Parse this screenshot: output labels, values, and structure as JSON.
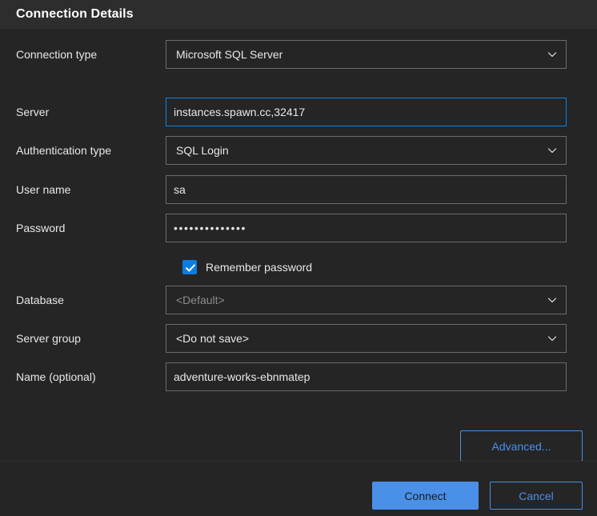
{
  "dialog": {
    "title": "Connection Details"
  },
  "fields": {
    "connection_type": {
      "label": "Connection type",
      "value": "Microsoft SQL Server",
      "icon": "chevron-down-icon"
    },
    "server": {
      "label": "Server",
      "value": "instances.spawn.cc,32417",
      "placeholder": ""
    },
    "authentication_type": {
      "label": "Authentication type",
      "value": "SQL Login",
      "icon": "chevron-down-icon"
    },
    "user_name": {
      "label": "User name",
      "value": "sa",
      "placeholder": ""
    },
    "password": {
      "label": "Password",
      "value": "••••••••••••••",
      "placeholder": ""
    },
    "remember_password": {
      "label": "Remember password",
      "checked": true
    },
    "database": {
      "label": "Database",
      "value": "<Default>",
      "icon": "chevron-down-icon"
    },
    "server_group": {
      "label": "Server group",
      "value": "<Do not save>",
      "icon": "chevron-down-icon"
    },
    "name_optional": {
      "label": "Name (optional)",
      "value": "adventure-works-ebnmatep",
      "placeholder": ""
    }
  },
  "buttons": {
    "advanced": "Advanced...",
    "connect": "Connect",
    "cancel": "Cancel"
  },
  "colors": {
    "accent_blue": "#4a90e8",
    "focus_blue": "#0a84e0",
    "checkbox_blue": "#0a7de0",
    "dialog_bg": "#252526",
    "header_bg": "#2d2d2d",
    "border": "#6b6b6b",
    "text": "#e8e8e8",
    "muted_text": "#8c8c8c"
  }
}
